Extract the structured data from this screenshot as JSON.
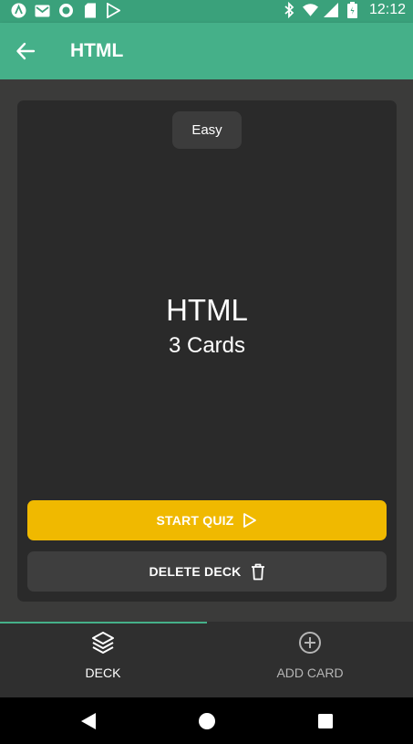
{
  "status_bar": {
    "time": "12:12",
    "left_icons": [
      "app-a-icon",
      "gmail-icon",
      "record-icon",
      "sd-card-icon",
      "play-store-icon"
    ],
    "right_icons": [
      "bluetooth-icon",
      "wifi-icon",
      "signal-icon",
      "battery-icon"
    ]
  },
  "app_bar": {
    "title": "HTML",
    "color": "#45b089"
  },
  "deck": {
    "difficulty": "Easy",
    "title": "HTML",
    "card_count": "3 Cards"
  },
  "actions": {
    "start_quiz": "START QUIZ",
    "delete_deck": "DELETE DECK",
    "start_color": "#f0b900"
  },
  "bottom_nav": {
    "tabs": [
      {
        "label": "DECK",
        "icon": "layers-icon",
        "active": true
      },
      {
        "label": "ADD CARD",
        "icon": "add-circle-icon",
        "active": false
      }
    ]
  }
}
